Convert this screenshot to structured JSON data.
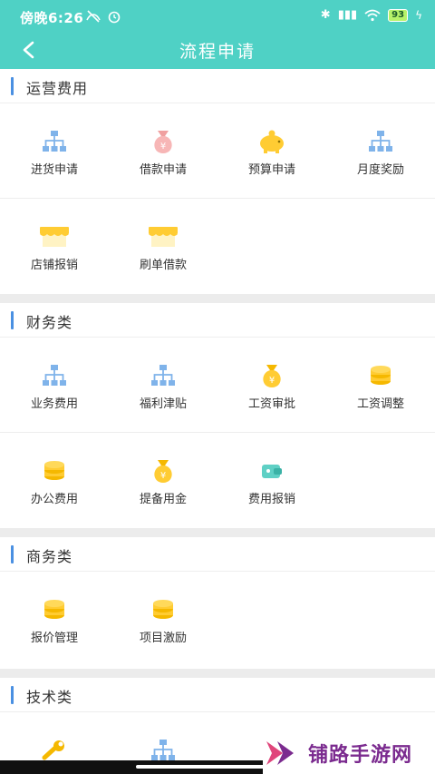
{
  "status": {
    "time": "傍晚6:26",
    "battery": "93"
  },
  "nav": {
    "title": "流程申请"
  },
  "sections": [
    {
      "title": "运营费用",
      "items": [
        {
          "label": "进货申请",
          "icon": "org-chart-icon"
        },
        {
          "label": "借款申请",
          "icon": "money-bag-pink-icon"
        },
        {
          "label": "预算申请",
          "icon": "piggy-bank-icon"
        },
        {
          "label": "月度奖励",
          "icon": "org-chart-icon"
        },
        {
          "label": "店铺报销",
          "icon": "shop-awning-icon"
        },
        {
          "label": "刷单借款",
          "icon": "shop-awning-icon"
        }
      ]
    },
    {
      "title": "财务类",
      "items": [
        {
          "label": "业务费用",
          "icon": "org-chart-icon"
        },
        {
          "label": "福利津贴",
          "icon": "org-chart-icon"
        },
        {
          "label": "工资审批",
          "icon": "money-bag-yellow-icon"
        },
        {
          "label": "工资调整",
          "icon": "coin-stack-icon"
        },
        {
          "label": "办公费用",
          "icon": "coin-stack-icon"
        },
        {
          "label": "提备用金",
          "icon": "money-bag-yellow-icon"
        },
        {
          "label": "费用报销",
          "icon": "wallet-icon"
        }
      ]
    },
    {
      "title": "商务类",
      "items": [
        {
          "label": "报价管理",
          "icon": "coin-stack-icon"
        },
        {
          "label": "项目激励",
          "icon": "coin-stack-icon"
        }
      ]
    },
    {
      "title": "技术类",
      "items": [
        {
          "label": "",
          "icon": "wrench-icon"
        },
        {
          "label": "",
          "icon": "org-chart-icon"
        }
      ]
    }
  ],
  "watermark": {
    "text": "铺路手游网"
  }
}
